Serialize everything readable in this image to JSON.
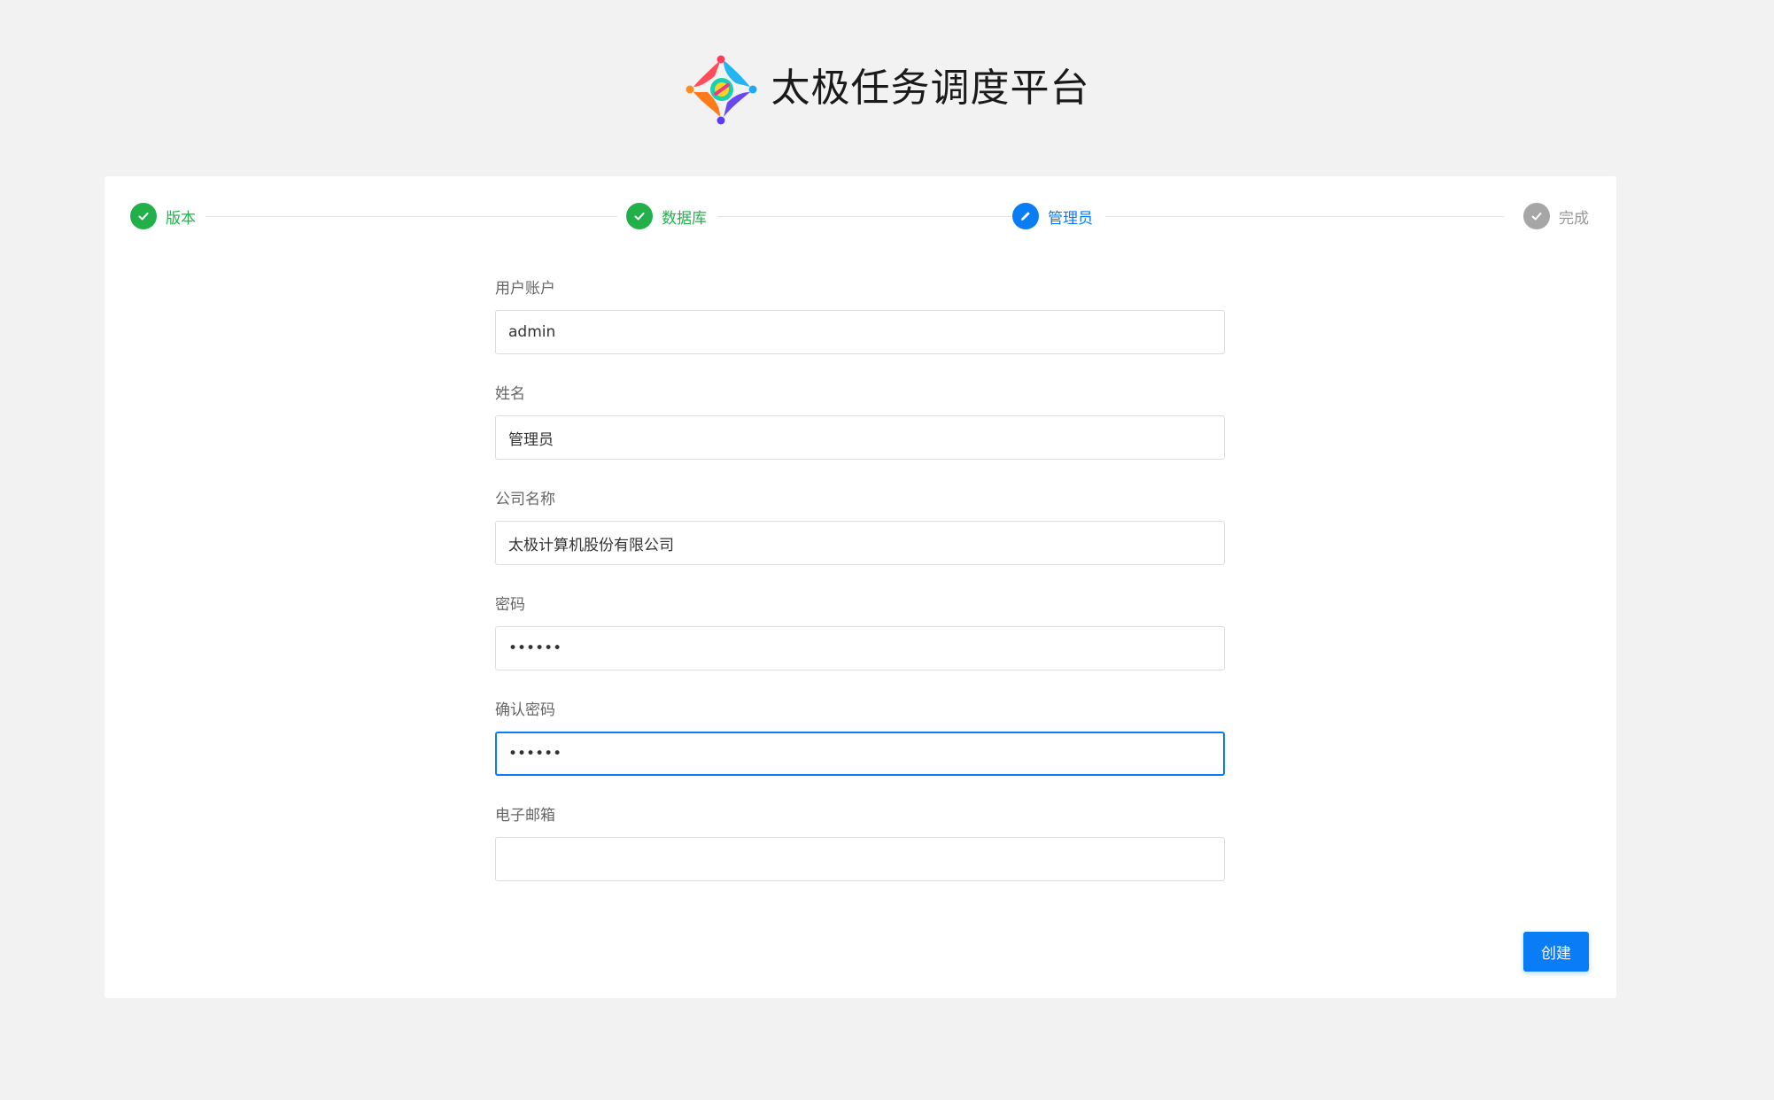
{
  "app": {
    "title": "太极任务调度平台"
  },
  "steps": [
    {
      "label": "版本",
      "status": "done"
    },
    {
      "label": "数据库",
      "status": "done"
    },
    {
      "label": "管理员",
      "status": "active"
    },
    {
      "label": "完成",
      "status": "pending"
    }
  ],
  "form": {
    "username": {
      "label": "用户账户",
      "value": "admin"
    },
    "fullname": {
      "label": "姓名",
      "value": "管理员"
    },
    "company": {
      "label": "公司名称",
      "value": "太极计算机股份有限公司"
    },
    "password": {
      "label": "密码",
      "value": "••••••"
    },
    "confirm_password": {
      "label": "确认密码",
      "value": "••••••"
    },
    "email": {
      "label": "电子邮箱",
      "value": ""
    }
  },
  "actions": {
    "create_label": "创建"
  },
  "colors": {
    "accent": "#0a7cf5",
    "success": "#22b04b",
    "pending": "#a6a6a6",
    "background": "#f2f2f2"
  }
}
